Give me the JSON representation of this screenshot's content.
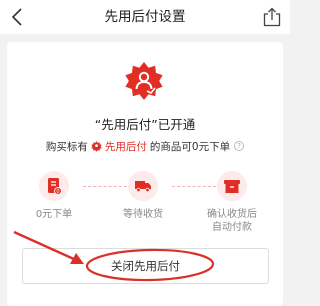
{
  "header": {
    "title": "先用后付设置"
  },
  "status": {
    "title": "“先用后付”已开通"
  },
  "description": {
    "prefix": "购买标有",
    "brand": "先用后付",
    "suffix": "的商品可0元下单",
    "help": "?"
  },
  "steps": [
    {
      "label": "0元下单",
      "icon": "order-doc-icon"
    },
    {
      "label": "等待收货",
      "icon": "truck-icon"
    },
    {
      "label": "确认收货后\n自动付款",
      "icon": "package-box-icon"
    }
  ],
  "close_button": {
    "label": "关闭先用后付"
  },
  "colors": {
    "accent": "#e02e24",
    "icon_bg": "#fdeaea",
    "annotation": "#d9302a"
  }
}
